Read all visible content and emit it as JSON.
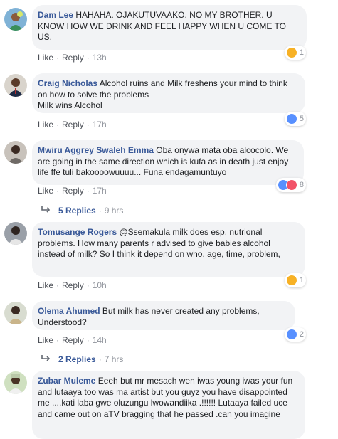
{
  "colors": {
    "link": "#385898",
    "bubble": "#f2f3f5",
    "like": "#5890ff",
    "haha": "#f7b125",
    "love": "#f25268"
  },
  "comments": [
    {
      "author": "Dam Lee",
      "text": "HAHAHA. OJAKUTUVAAKO. NO MY BROTHER. U KNOW HOW WE DRINK AND FEEL HAPPY WHEN U COME TO US.",
      "like_label": "Like",
      "reply_label": "Reply",
      "time": "13h",
      "reaction_icons": [
        "haha-icon"
      ],
      "reaction_count": "1"
    },
    {
      "author": "Craig Nicholas",
      "text": "Alcohol ruins and Milk freshens your mind to think on how to solve the problems",
      "text2": "Milk wins Alcohol",
      "like_label": "Like",
      "reply_label": "Reply",
      "time": "17h",
      "reaction_icons": [
        "like-icon"
      ],
      "reaction_count": "5"
    },
    {
      "author": "Mwiru Aggrey Swaleh Emma",
      "text": "Oba onywa mata oba alcocolo. We are going in the same direction which is kufa as in death just enjoy life ffe tuli bakoooowuuuu... Funa endagamuntuyo",
      "like_label": "Like",
      "reply_label": "Reply",
      "time": "17h",
      "reaction_icons": [
        "like-icon",
        "love-icon"
      ],
      "reaction_count": "8",
      "replies_label": "5 Replies",
      "replies_time": "9 hrs"
    },
    {
      "author": "Tomusange Rogers",
      "text": "@Ssemakula milk does esp. nutrional problems. How many parents r advised to give babies alcohol instead of milk? So I think it depend on who, age, time, problem,",
      "like_label": "Like",
      "reply_label": "Reply",
      "time": "10h",
      "reaction_icons": [
        "haha-icon"
      ],
      "reaction_count": "1"
    },
    {
      "author": "Olema Ahumed",
      "text": "But milk has never created any problems, Understood?",
      "like_label": "Like",
      "reply_label": "Reply",
      "time": "14h",
      "reaction_icons": [
        "like-icon"
      ],
      "reaction_count": "2",
      "replies_label": "2 Replies",
      "replies_time": "7 hrs"
    },
    {
      "author": "Zubar Muleme",
      "text": "Eeeh but mr mesach wen iwas young iwas your fun and lutaaya too was ma artist but you guyz you have disappointed me ....kati laba gwe oluzungu lwowandiika .!!!!!! Lutaaya failed uce and came out on aTV bragging that he passed .can you imagine"
    }
  ]
}
